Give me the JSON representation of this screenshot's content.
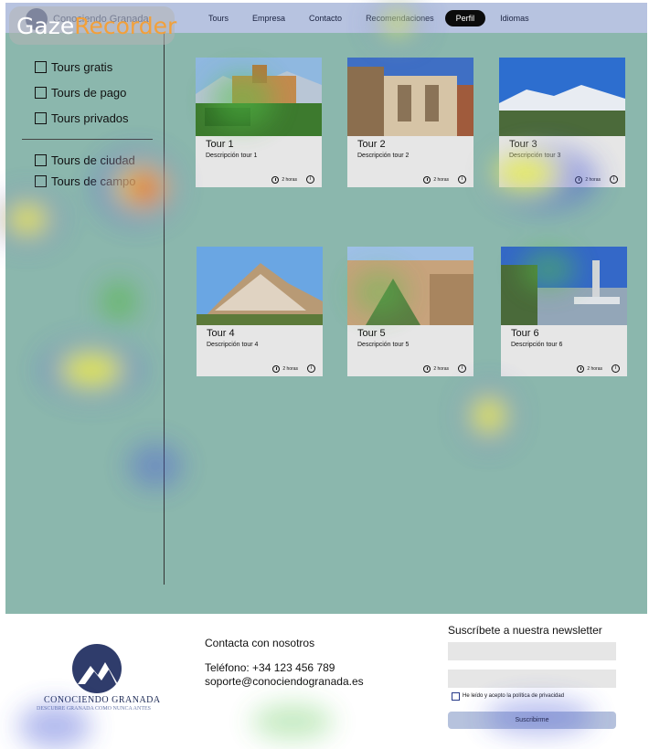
{
  "header": {
    "brand": "Conociendo Granada",
    "nav": [
      "Tours",
      "Empresa",
      "Contacto",
      "Recomendaciones",
      "Perfil",
      "Idiomas"
    ],
    "active_nav": "Perfil"
  },
  "watermark": {
    "part1": "Gaze",
    "part2": "Recorder"
  },
  "filters": {
    "type": [
      "Tours gratis",
      "Tours de pago",
      "Tours privados"
    ],
    "location": [
      "Tours de ciudad",
      "Tours de campo"
    ]
  },
  "tours": [
    {
      "title": "Tour 1",
      "description": "Descripción tour 1",
      "duration": "2 horas",
      "image": "alhambra"
    },
    {
      "title": "Tour 2",
      "description": "Descripción tour 2",
      "duration": "2 horas",
      "image": "cathedral"
    },
    {
      "title": "Tour 3",
      "description": "Descripción tour 3",
      "duration": "2 horas",
      "image": "sierra-nevada"
    },
    {
      "title": "Tour 4",
      "description": "Descripción tour 4",
      "duration": "2 horas",
      "image": "hill-village"
    },
    {
      "title": "Tour 5",
      "description": "Descripción tour 5",
      "duration": "2 horas",
      "image": "canyon"
    },
    {
      "title": "Tour 6",
      "description": "Descripción tour 6",
      "duration": "2 horas",
      "image": "fountain"
    }
  ],
  "footer": {
    "brand": "CONOCIENDO GRANADA",
    "tagline": "DESCUBRE GRANADA COMO NUNCA ANTES",
    "contact_heading": "Contacta con nosotros",
    "phone": "Teléfono: +34 123 456 789",
    "email": "soporte@conociendogranada.es",
    "newsletter_heading": "Suscríbete a nuestra newsletter",
    "privacy_label": "He leído y acepto la política de privacidad",
    "subscribe_label": "Suscribirme"
  },
  "colors": {
    "nav_bg": "#b7c3e0",
    "main_bg": "#8bb7ad",
    "active_nav": "#0b0b0b",
    "brand_blue": "#2f3c6b"
  }
}
